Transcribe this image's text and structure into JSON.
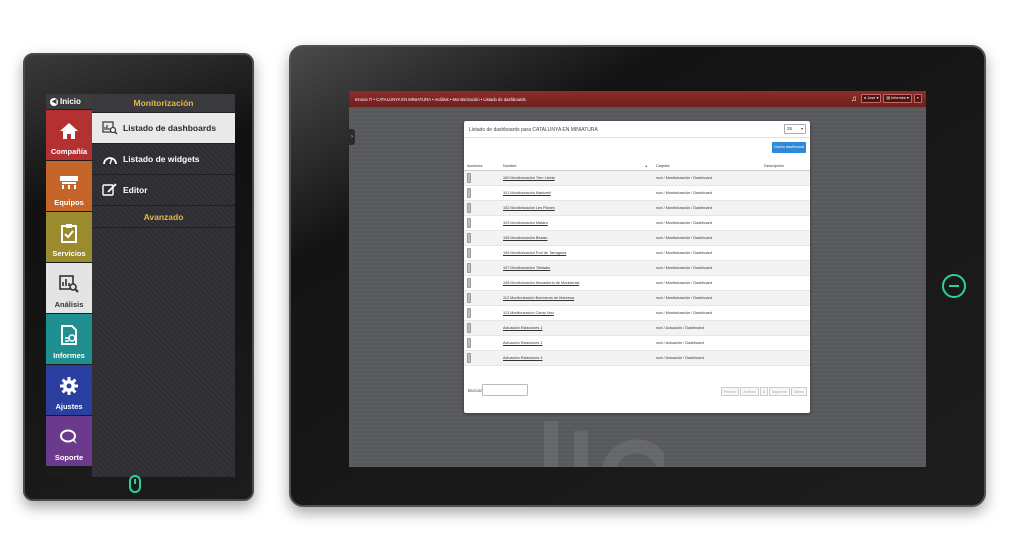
{
  "small_tablet": {
    "rail": {
      "home_label": "Inicio",
      "items": [
        {
          "label": "Compañía",
          "icon": "home-icon",
          "color": "#b43131"
        },
        {
          "label": "Equipos",
          "icon": "server-icon",
          "color": "#c5652a"
        },
        {
          "label": "Servicios",
          "icon": "clipboard-check-icon",
          "color": "#9a8b2f"
        },
        {
          "label": "Análisis",
          "icon": "chart-search-icon",
          "color": "#e4e4e4"
        },
        {
          "label": "Informes",
          "icon": "report-icon",
          "color": "#1f8f8f"
        },
        {
          "label": "Ajustes",
          "icon": "gear-icon",
          "color": "#2a3fa0"
        },
        {
          "label": "Soporte",
          "icon": "chat-bubbles-icon",
          "color": "#6c3a8c"
        }
      ]
    },
    "submenu": {
      "section1_title": "Monitorización",
      "items": [
        {
          "label": "Listado de dashboards",
          "icon": "chart-search-icon"
        },
        {
          "label": "Listado de widgets",
          "icon": "gauge-icon"
        },
        {
          "label": "Editor",
          "icon": "edit-icon"
        }
      ],
      "section2_title": "Avanzado"
    }
  },
  "large_tablet": {
    "topbar": {
      "breadcrumb": "Innova IT • CATALUNYA EN MINIATURA • Análisis • Monitorización • Listado de dashboards",
      "user_label": "Jose",
      "reports_label": "Informes"
    },
    "panel": {
      "title": "Listado de dashboards para CATALUNYA EN MINIATURA",
      "page_size": "25",
      "new_button": "Nuevo dashboard",
      "columns": [
        "Acciones",
        "Nombre",
        "Carpeta",
        "Descripción"
      ],
      "rows": [
        {
          "name": "100 Monitorización Tren Lleida",
          "folder": "root / Monitorización / Dashboard"
        },
        {
          "name": "101 Monitorización Martorell",
          "folder": "root / Monitorización / Dashboard"
        },
        {
          "name": "102 Monitorización Les Planes",
          "folder": "root / Monitorización / Dashboard"
        },
        {
          "name": "103 Monitorización Mataro",
          "folder": "root / Monitorización / Dashboard"
        },
        {
          "name": "105 Monitorización Besalu",
          "folder": "root / Monitorización / Dashboard"
        },
        {
          "name": "106 Monitorización Port de Tarragona",
          "folder": "root / Monitorización / Dashboard"
        },
        {
          "name": "107 Monitorización Tibidabo",
          "folder": "root / Monitorización / Dashboard"
        },
        {
          "name": "108 Monitorización Monasterio de Montserrat",
          "folder": "root / Monitorización / Dashboard"
        },
        {
          "name": "112 Monitorización Bomberos de Manresa",
          "folder": "root / Monitorización / Dashboard"
        },
        {
          "name": "113 Monitorización Camp Nou",
          "folder": "root / Monitorización / Dashboard"
        },
        {
          "name": "Actuación Estaciones 1",
          "folder": "root / Actuación / Dashboard"
        },
        {
          "name": "Actuación Estaciones 2",
          "folder": "root / Actuación / Dashboard"
        },
        {
          "name": "Actuación Estaciones 3",
          "folder": "root / Actuación / Dashboard"
        }
      ],
      "search_label": "Buscar",
      "pager": [
        "Primero",
        "Anterior",
        "1",
        "Siguiente",
        "Último"
      ]
    }
  }
}
